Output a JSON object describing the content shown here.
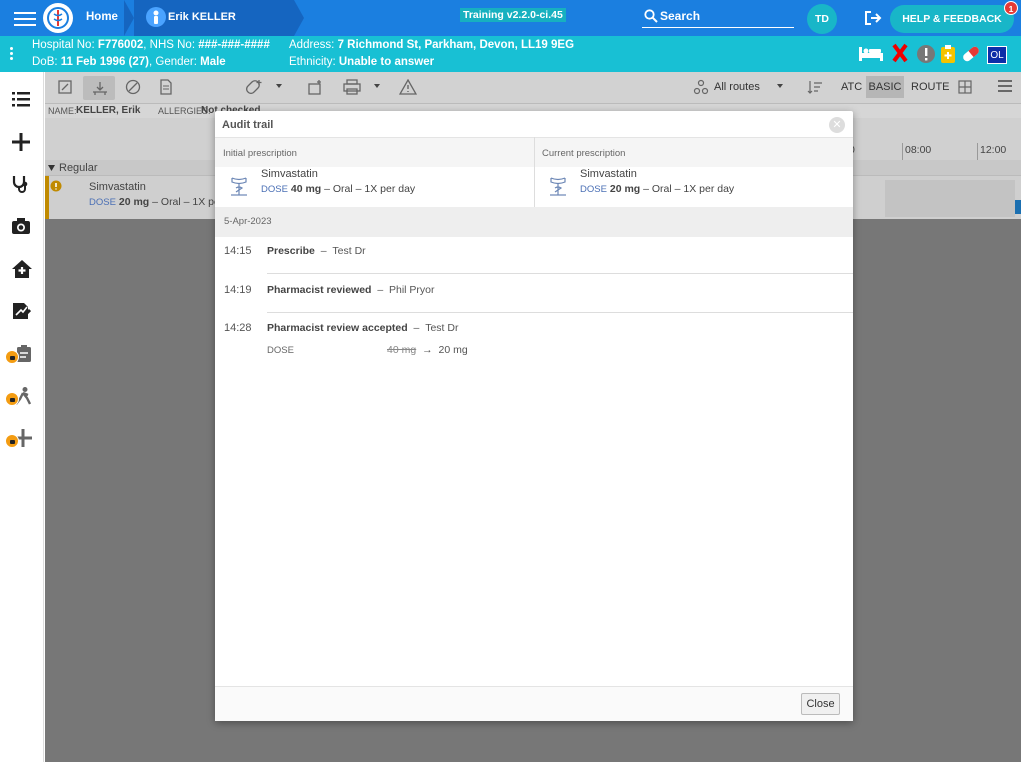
{
  "topbar": {
    "home": "Home",
    "patient_name": "Erik KELLER",
    "training": "Training v2.2.0-ci.45",
    "search": "Search",
    "avatar": "TD",
    "help": "HELP & FEEDBACK",
    "help_badge": "1"
  },
  "patient": {
    "line1_a": "Hospital No: ",
    "hospital_no": "F776002",
    "line1_b": ", NHS No: ",
    "nhs_no": "###-###-####",
    "line2_a": "DoB: ",
    "dob": "11 Feb 1996 (27)",
    "line2_b": ", Gender: ",
    "gender": "Male",
    "addr_label": "Address: ",
    "address": "7 Richmond St, Parkham, Devon, LL19 9EG",
    "eth_label": "Ethnicity: ",
    "ethnicity": "Unable to answer",
    "ol": "OL"
  },
  "toolbar": {
    "routes": "All routes",
    "atc": "ATC",
    "basic": "BASIC",
    "route": "ROUTE"
  },
  "info": {
    "name_label": "NAME:",
    "name": "KELLER, Erik",
    "allergies_label": "ALLERGIES:",
    "allergies": "Not checked"
  },
  "grid": {
    "times": [
      "0",
      "08:00",
      "12:00"
    ],
    "group": "Regular",
    "med_name": "Simvastatin",
    "med_dose_label": "DOSE",
    "med_dose": "20 mg",
    "med_rest": "– Oral – 1X pe"
  },
  "modal": {
    "title": "Audit trail",
    "initial_label": "Initial prescription",
    "current_label": "Current prescription",
    "initial": {
      "name": "Simvastatin",
      "dose_label": "DOSE",
      "dose": "40 mg",
      "rest": " – Oral – 1X per day"
    },
    "current": {
      "name": "Simvastatin",
      "dose_label": "DOSE",
      "dose": "20 mg",
      "rest": " – Oral – 1X per day"
    },
    "date": "5-Apr-2023",
    "events": [
      {
        "time": "14:15",
        "action": "Prescribe",
        "by": "Test Dr"
      },
      {
        "time": "14:19",
        "action": "Pharmacist reviewed",
        "by": "Phil Pryor"
      },
      {
        "time": "14:28",
        "action": "Pharmacist review accepted",
        "by": "Test Dr"
      }
    ],
    "change": {
      "field": "DOSE",
      "from": "40 mg",
      "arrow": "→",
      "to": "20 mg"
    },
    "close": "Close"
  },
  "colors": {
    "topbar": "#1b7fe0",
    "patient_bar": "#18c0d4",
    "accent": "#18b6c8"
  }
}
